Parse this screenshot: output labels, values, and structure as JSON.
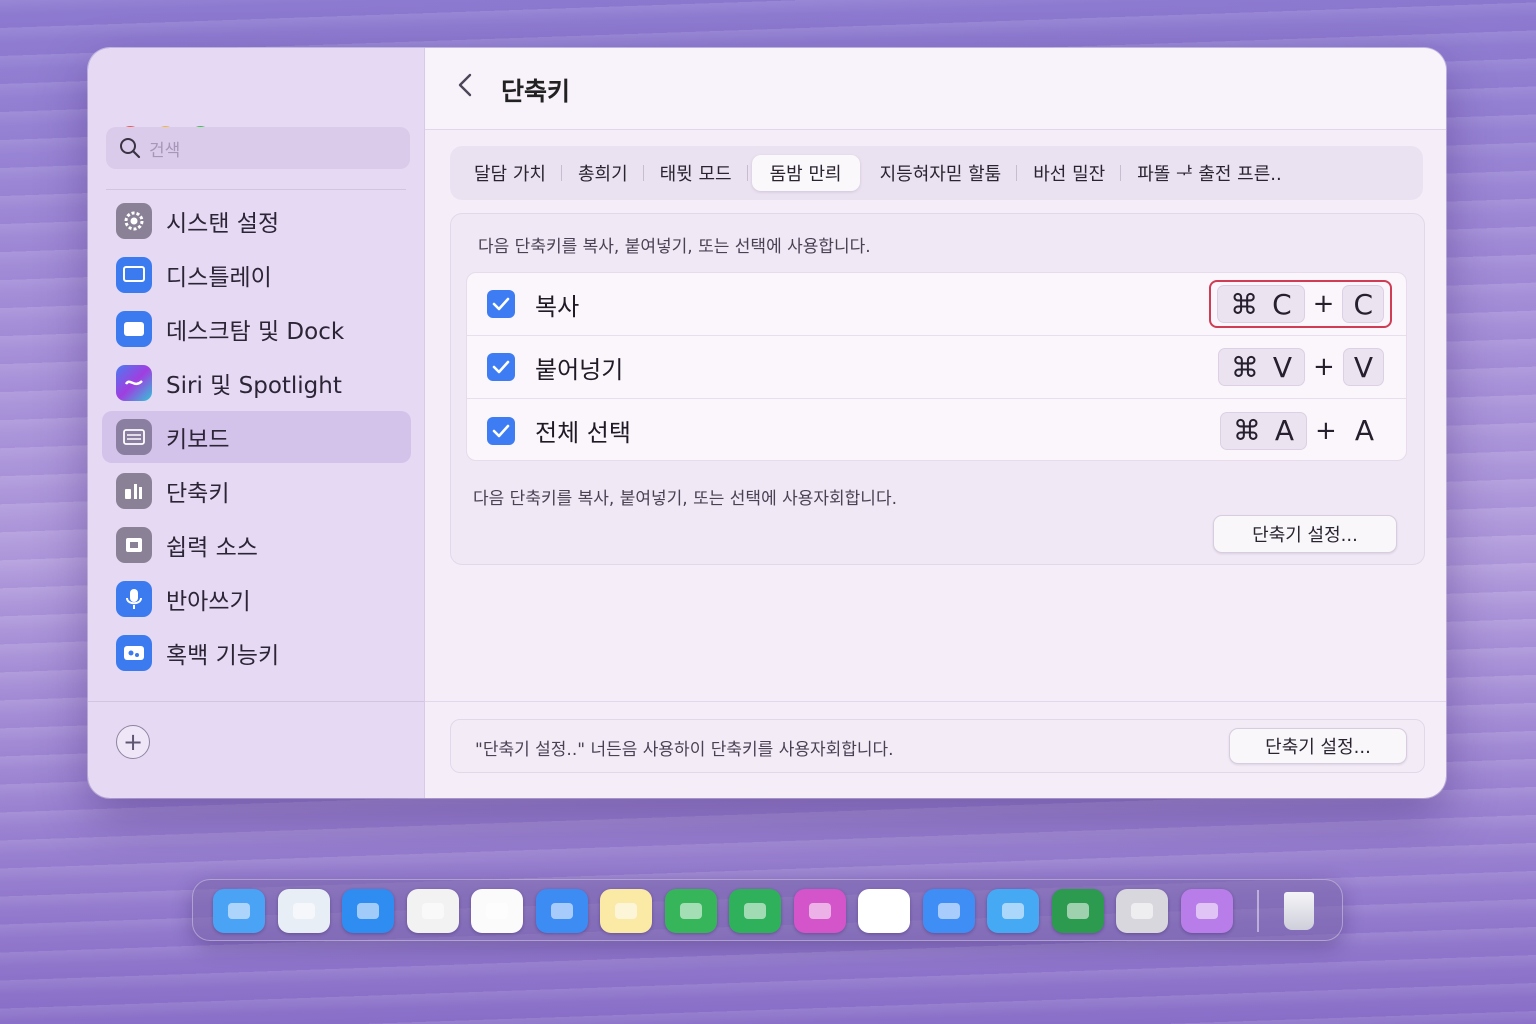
{
  "window": {
    "title": "단축키",
    "search_placeholder": "건색"
  },
  "sidebar": {
    "items": [
      {
        "label": "시스탠 설정",
        "icon": "gear-icon",
        "color": "#8a8196"
      },
      {
        "label": "디스틀레이",
        "icon": "display-icon",
        "color": "#3b7bef"
      },
      {
        "label": "데스크탐 및 Dock",
        "icon": "dock-icon",
        "color": "#3b7bef"
      },
      {
        "label": "Siri 및 Spotlight",
        "icon": "siri-icon",
        "color": "#7a4ae0"
      },
      {
        "label": "키보드",
        "icon": "keyboard-icon",
        "color": "#8a7fa0"
      },
      {
        "label": "단축키",
        "icon": "shortcuts-icon",
        "color": "#8a8196"
      },
      {
        "label": "쉽력 소스",
        "icon": "input-source-icon",
        "color": "#8a8196"
      },
      {
        "label": "반아쓰기",
        "icon": "microphone-icon",
        "color": "#3b7bef"
      },
      {
        "label": "혹백 기능키",
        "icon": "function-keys-icon",
        "color": "#3b7bef"
      }
    ],
    "active_index": 4,
    "add_label": "+"
  },
  "tabs": [
    {
      "label": "달담 가치"
    },
    {
      "label": "총희기"
    },
    {
      "label": "태뮛 모드"
    },
    {
      "label": "돔밤 만릐"
    },
    {
      "label": "지등혀자믿 할툼"
    },
    {
      "label": "바선 밀잔"
    },
    {
      "label": "파똘 ᅷ 출전 프른.."
    }
  ],
  "active_tab": 3,
  "panel": {
    "description": "다음 단축키를 복사, 붙여넣기, 또는 선택에 사용합니다.",
    "rows": [
      {
        "label": "복사",
        "checked": true,
        "modifier": "⌘",
        "key": "C",
        "plus": "+",
        "alt_key": "C",
        "highlighted": true
      },
      {
        "label": "붙어넝기",
        "checked": true,
        "modifier": "⌘",
        "key": "V",
        "plus": "+",
        "alt_key": "V",
        "highlighted": false
      },
      {
        "label": "전체 선택",
        "checked": true,
        "modifier": "⌘",
        "key": "A",
        "plus": "+",
        "alt_key": "A",
        "highlighted": false
      }
    ],
    "description2": "다음 단축키를 복사, 붙여넣기, 또는 선택에 사용자회합니다.",
    "button": "단축기 설정..."
  },
  "footer": {
    "text": "\"단축기 설정..\" 너든음 사용하이 단축키를 사용자회합니다.",
    "button": "단축기 설정..."
  },
  "dock": {
    "apps": [
      {
        "name": "finder-icon",
        "color": "#4aa3f5"
      },
      {
        "name": "preview-icon",
        "color": "#e8eef6"
      },
      {
        "name": "safari-icon",
        "color": "#2f8cf0"
      },
      {
        "name": "chrome-icon",
        "color": "#f2f2f2"
      },
      {
        "name": "photos-icon",
        "color": "#fbfbfb"
      },
      {
        "name": "mail-icon",
        "color": "#3d8cf3"
      },
      {
        "name": "notes-icon",
        "color": "#fbe9a6"
      },
      {
        "name": "books-icon",
        "color": "#36b55a"
      },
      {
        "name": "numbers-icon",
        "color": "#2fb05a"
      },
      {
        "name": "keynote-icon",
        "color": "#d454c9"
      },
      {
        "name": "messages-icon",
        "color": "#ffffff"
      },
      {
        "name": "reminders-icon",
        "color": "#3f8ef5"
      },
      {
        "name": "tasks-icon",
        "color": "#46a9f4"
      },
      {
        "name": "excel-icon",
        "color": "#2c9a4f"
      },
      {
        "name": "disk-utility-icon",
        "color": "#d9d7de"
      },
      {
        "name": "toggle-app-icon",
        "color": "#b87de8"
      },
      {
        "name": "trash-icon",
        "color": "#e4e4ec"
      }
    ]
  }
}
